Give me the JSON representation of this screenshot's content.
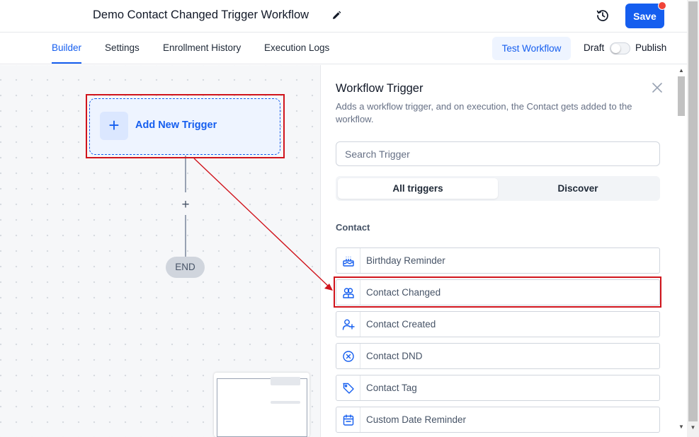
{
  "header": {
    "title": "Demo Contact Changed Trigger Workflow",
    "save_label": "Save"
  },
  "tabs": [
    {
      "label": "Builder",
      "active": true
    },
    {
      "label": "Settings",
      "active": false
    },
    {
      "label": "Enrollment History",
      "active": false
    },
    {
      "label": "Execution Logs",
      "active": false
    }
  ],
  "actions": {
    "test_workflow_label": "Test Workflow",
    "draft_label": "Draft",
    "publish_label": "Publish",
    "publish_toggle_on": false
  },
  "canvas": {
    "trigger_label": "Add New Trigger",
    "add_step_symbol": "+",
    "end_label": "END"
  },
  "panel": {
    "title": "Workflow Trigger",
    "description": "Adds a workflow trigger, and on execution, the Contact gets added to the workflow.",
    "search_placeholder": "Search Trigger",
    "segments": [
      {
        "label": "All triggers",
        "active": true
      },
      {
        "label": "Discover",
        "active": false
      }
    ],
    "section_label": "Contact",
    "triggers": [
      {
        "label": "Birthday Reminder",
        "icon": "birthday-cake-icon"
      },
      {
        "label": "Contact Changed",
        "icon": "contact-changed-icon",
        "highlighted": true
      },
      {
        "label": "Contact Created",
        "icon": "user-plus-icon"
      },
      {
        "label": "Contact DND",
        "icon": "circle-x-icon"
      },
      {
        "label": "Contact Tag",
        "icon": "tag-icon"
      },
      {
        "label": "Custom Date Reminder",
        "icon": "calendar-icon"
      }
    ]
  },
  "colors": {
    "accent": "#155eef",
    "highlight": "#d0141c",
    "notification_dot": "#f04438"
  }
}
